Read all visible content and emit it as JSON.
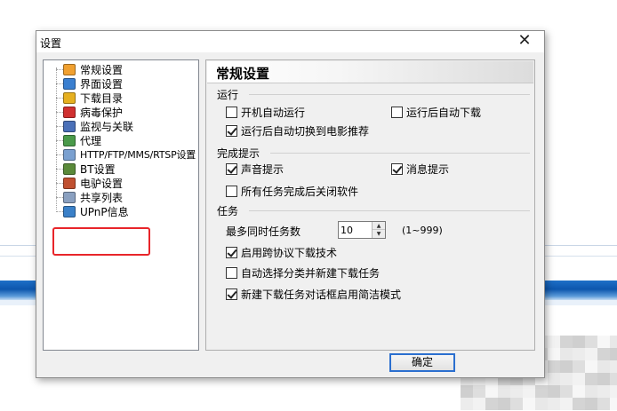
{
  "dialog": {
    "title": "设置",
    "close_glyph": "✕",
    "ok_label": "确定"
  },
  "tree": {
    "items": [
      {
        "label": "常规设置",
        "icon": "general-settings-icon",
        "color": "#f0a030"
      },
      {
        "label": "界面设置",
        "icon": "interface-settings-icon",
        "color": "#3a7fd0"
      },
      {
        "label": "下载目录",
        "icon": "download-folder-icon",
        "color": "#e6b020"
      },
      {
        "label": "病毒保护",
        "icon": "virus-protection-icon",
        "color": "#d03030"
      },
      {
        "label": "监视与关联",
        "icon": "monitor-icon",
        "color": "#4a70b8"
      },
      {
        "label": "代理",
        "icon": "proxy-icon",
        "color": "#4a9a4a"
      },
      {
        "label": "HTTP/FTP/MMS/RTSP设置",
        "icon": "http-settings-icon",
        "color": "#7aa0d0"
      },
      {
        "label": "BT设置",
        "icon": "bt-settings-icon",
        "color": "#5a8a3a"
      },
      {
        "label": "电驴设置",
        "icon": "emule-settings-icon",
        "color": "#c05030"
      },
      {
        "label": "共享列表",
        "icon": "share-list-icon",
        "color": "#8aa0c0"
      },
      {
        "label": "UPnP信息",
        "icon": "upnp-info-icon",
        "color": "#3a80c8"
      }
    ],
    "highlight_color": "#e8252a"
  },
  "panel": {
    "title": "常规设置",
    "groups": {
      "run": "运行",
      "notify": "完成提示",
      "task": "任务"
    },
    "options": {
      "auto_start": {
        "label": "开机自动运行",
        "checked": false
      },
      "auto_download": {
        "label": "运行后自动下载",
        "checked": false
      },
      "movie_recommend": {
        "label": "运行后自动切换到电影推荐",
        "checked": true
      },
      "sound_notify": {
        "label": "声音提示",
        "checked": true
      },
      "message_notify": {
        "label": "消息提示",
        "checked": true
      },
      "close_after_done": {
        "label": "所有任务完成后关闭软件",
        "checked": false
      },
      "cross_protocol": {
        "label": "启用跨协议下载技术",
        "checked": true
      },
      "auto_category": {
        "label": "自动选择分类并新建下载任务",
        "checked": false
      },
      "simple_mode": {
        "label": "新建下载任务对话框启用简洁模式",
        "checked": true
      }
    },
    "max_tasks": {
      "label": "最多同时任务数",
      "value": "10",
      "range": "(1~999)"
    }
  },
  "colors": {
    "accent": "#2b6fcf",
    "band": "#0d56ad"
  }
}
